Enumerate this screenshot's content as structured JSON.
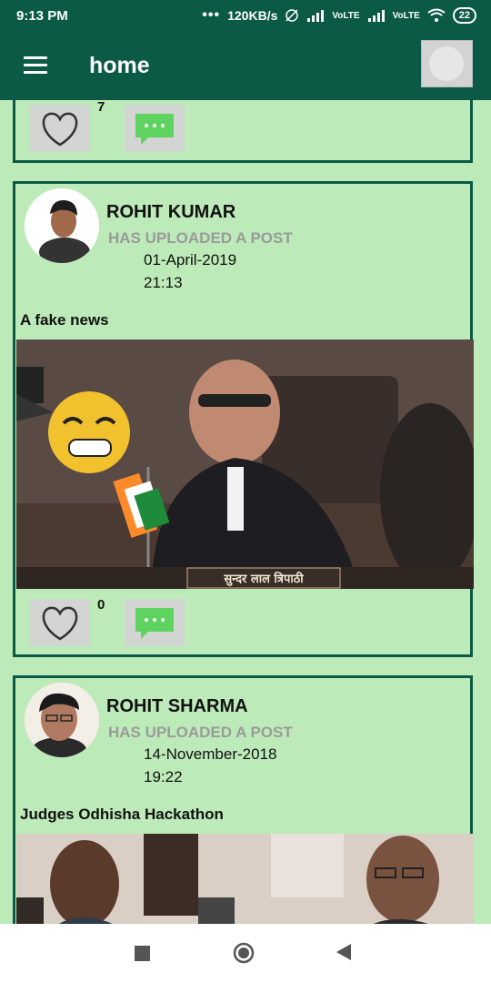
{
  "status_bar": {
    "time": "9:13 PM",
    "dots": "•••",
    "net_speed": "120KB/s",
    "sim1": "VoLTE",
    "sim2": "VoLTE",
    "battery": "22"
  },
  "app_bar": {
    "title": "home",
    "menu_icon": "hamburger-menu-icon",
    "profile_icon": "image-placeholder-icon"
  },
  "feed": {
    "partial_card": {
      "like_count": "7"
    },
    "posts": [
      {
        "author": "ROHIT KUMAR",
        "subtitle": "HAS UPLOADED A POST",
        "date": "01-April-2019",
        "time": "21:13",
        "title": "A fake news",
        "like_count": "0",
        "image_caption": "सुन्दर लाल त्रिपाठी"
      },
      {
        "author": "ROHIT SHARMA",
        "subtitle": "HAS UPLOADED A POST",
        "date": "14-November-2018",
        "time": "19:22",
        "title": "Judges Odhisha Hackathon"
      }
    ]
  },
  "colors": {
    "header": "#0b5a45",
    "background": "#bdeab9",
    "comment_green": "#5fd35f"
  }
}
